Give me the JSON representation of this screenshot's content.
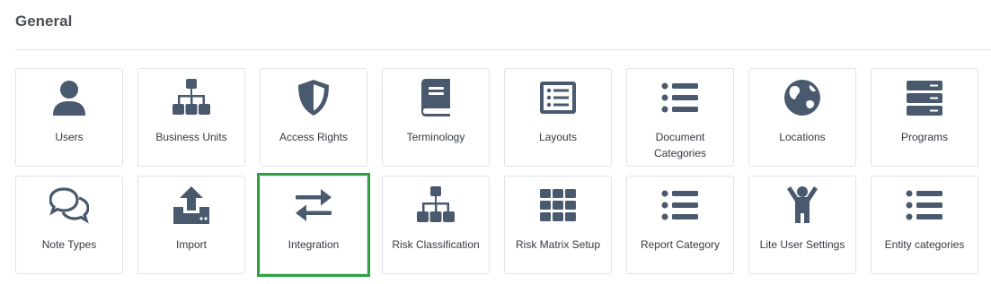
{
  "section": {
    "title": "General"
  },
  "tiles": [
    {
      "label": "Users",
      "icon": "user-icon"
    },
    {
      "label": "Business Units",
      "icon": "org-chart-icon"
    },
    {
      "label": "Access Rights",
      "icon": "shield-icon"
    },
    {
      "label": "Terminology",
      "icon": "book-icon"
    },
    {
      "label": "Layouts",
      "icon": "list-alt-icon"
    },
    {
      "label": "Document Categories",
      "icon": "list-icon"
    },
    {
      "label": "Locations",
      "icon": "globe-icon"
    },
    {
      "label": "Programs",
      "icon": "server-icon"
    },
    {
      "label": "Note Types",
      "icon": "comments-icon"
    },
    {
      "label": "Import",
      "icon": "upload-icon"
    },
    {
      "label": "Integration",
      "icon": "exchange-icon",
      "selected": true
    },
    {
      "label": "Risk Classification",
      "icon": "org-chart-icon"
    },
    {
      "label": "Risk Matrix Setup",
      "icon": "grid-icon"
    },
    {
      "label": "Report Category",
      "icon": "list-icon"
    },
    {
      "label": "Lite User Settings",
      "icon": "child-icon"
    },
    {
      "label": "Entity categories",
      "icon": "list-icon"
    }
  ],
  "colors": {
    "icon": "#4a5a6e",
    "selected_border": "#2ea043",
    "tile_border": "#dde3ea"
  }
}
